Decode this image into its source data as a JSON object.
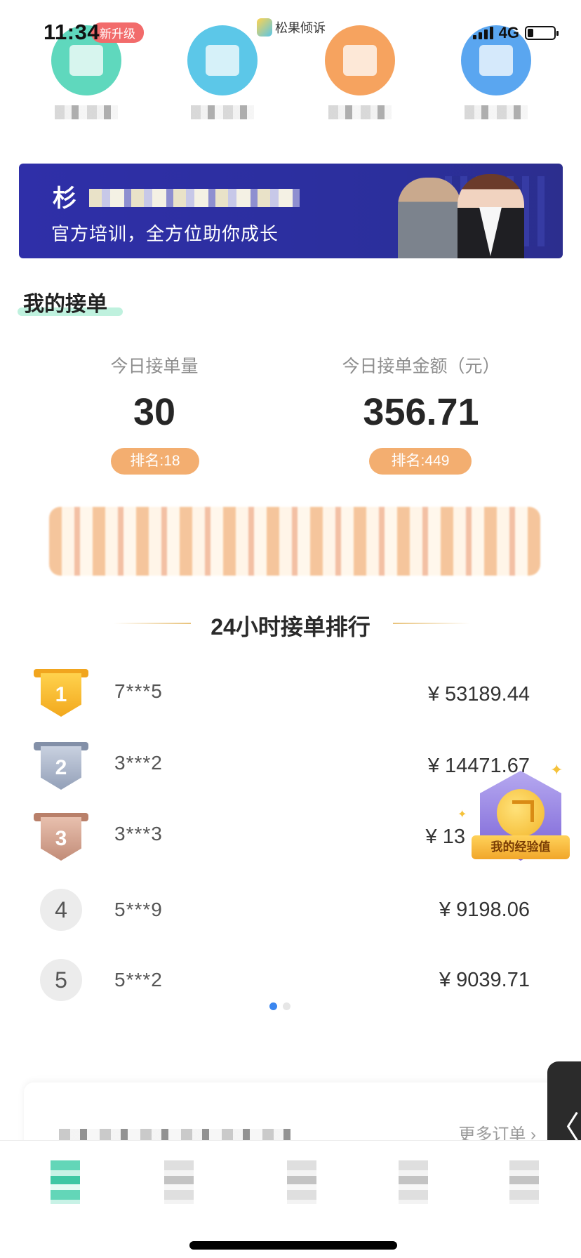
{
  "status_bar": {
    "time": "11:34",
    "network": "4G",
    "app_name": "松果倾诉"
  },
  "quick_entries": {
    "badge": "新升级",
    "items": [
      {
        "icon": "book-icon",
        "color": "#5fd8bd"
      },
      {
        "icon": "video-icon",
        "color": "#5cc7e8"
      },
      {
        "icon": "gift-icon",
        "color": "#f6a35f"
      },
      {
        "icon": "document-icon",
        "color": "#5aa6f0"
      }
    ]
  },
  "banner": {
    "title_start": "杉",
    "subtitle": "官方培训，全方位助你成长"
  },
  "my_orders": {
    "title": "我的接单",
    "today_count_label": "今日接单量",
    "today_count": "30",
    "today_count_rank": "排名:18",
    "today_amount_label": "今日接单金额（元）",
    "today_amount": "356.71",
    "today_amount_rank": "排名:449"
  },
  "ranking": {
    "title": "24小时接单排行",
    "rows": [
      {
        "rank": "1",
        "user": "7***5",
        "amount": "¥ 53189.44"
      },
      {
        "rank": "2",
        "user": "3***2",
        "amount": "¥ 14471.67"
      },
      {
        "rank": "3",
        "user": "3***3",
        "amount": "¥ 13"
      },
      {
        "rank": "4",
        "user": "5***9",
        "amount": "¥ 9198.06"
      },
      {
        "rank": "5",
        "user": "5***2",
        "amount": "¥ 9039.71"
      }
    ],
    "page_dots": {
      "active": "#3a86ef",
      "inactive": "#e6e6e6"
    }
  },
  "experience_badge": {
    "label": "我的经验值"
  },
  "bottom_card": {
    "more_orders": "更多订单 ›"
  },
  "side_tab": {
    "label": "〈"
  },
  "colors": {
    "accent_green": "#5fd8bd",
    "rank_pill": "#f3ae70",
    "banner_bg": "#2f2fa8",
    "gold": "#f5b92f",
    "silver": "#9fa9bf",
    "bronze": "#c99783"
  }
}
